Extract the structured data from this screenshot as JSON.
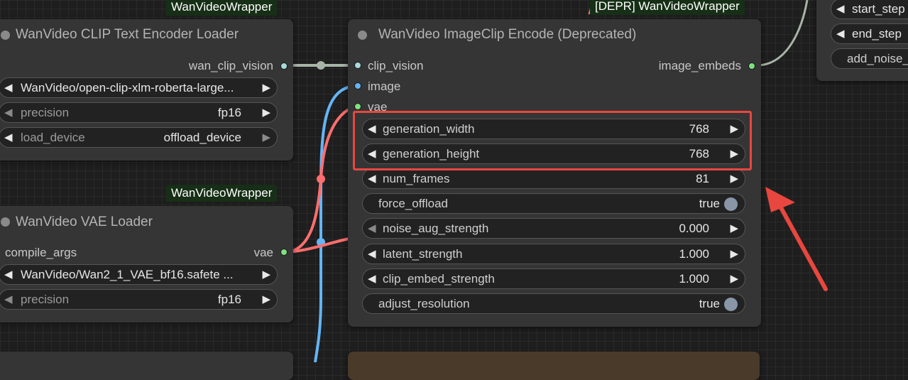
{
  "colors": {
    "canvas": "#1e1e1e",
    "node": "#353535",
    "badge": "#162f16",
    "clip_vision": "#a8dadc",
    "image": "#64b5f6",
    "vae": "#ff6e6e",
    "latent": "#9bb09b",
    "highlight": "#e8473f",
    "output_dot": "#7ee07e"
  },
  "clip_loader": {
    "badge": "WanVideoWrapper",
    "title": "WanVideo CLIP Text Encoder Loader",
    "output": "wan_clip_vision",
    "model": "WanVideo/open-clip-xlm-roberta-large...",
    "precision_label": "precision",
    "precision_value": "fp16",
    "load_device_label": "load_device",
    "load_device_value": "offload_device"
  },
  "vae_loader": {
    "badge": "WanVideoWrapper",
    "title": "WanVideo VAE Loader",
    "input": "compile_args",
    "output": "vae",
    "model": "WanVideo/Wan2_1_VAE_bf16.safete ...",
    "precision_label": "precision",
    "precision_value": "fp16"
  },
  "encode_node": {
    "badge": "[DEPR] WanVideoWrapper",
    "title": "WanVideo ImageClip Encode (Deprecated)",
    "inputs": [
      "clip_vision",
      "image",
      "vae"
    ],
    "output": "image_embeds",
    "widgets": [
      {
        "label": "generation_width",
        "value": "768"
      },
      {
        "label": "generation_height",
        "value": "768"
      },
      {
        "label": "num_frames",
        "value": "81"
      },
      {
        "label": "force_offload",
        "value": "true"
      },
      {
        "label": "noise_aug_strength",
        "value": "0.000"
      },
      {
        "label": "latent_strength",
        "value": "1.000"
      },
      {
        "label": "clip_embed_strength",
        "value": "1.000"
      },
      {
        "label": "adjust_resolution",
        "value": "true"
      }
    ]
  },
  "sampler_node": {
    "widgets": [
      "start_step",
      "end_step",
      "add_noise_"
    ]
  },
  "glyphs": {
    "left": "◀",
    "right": "▶"
  }
}
